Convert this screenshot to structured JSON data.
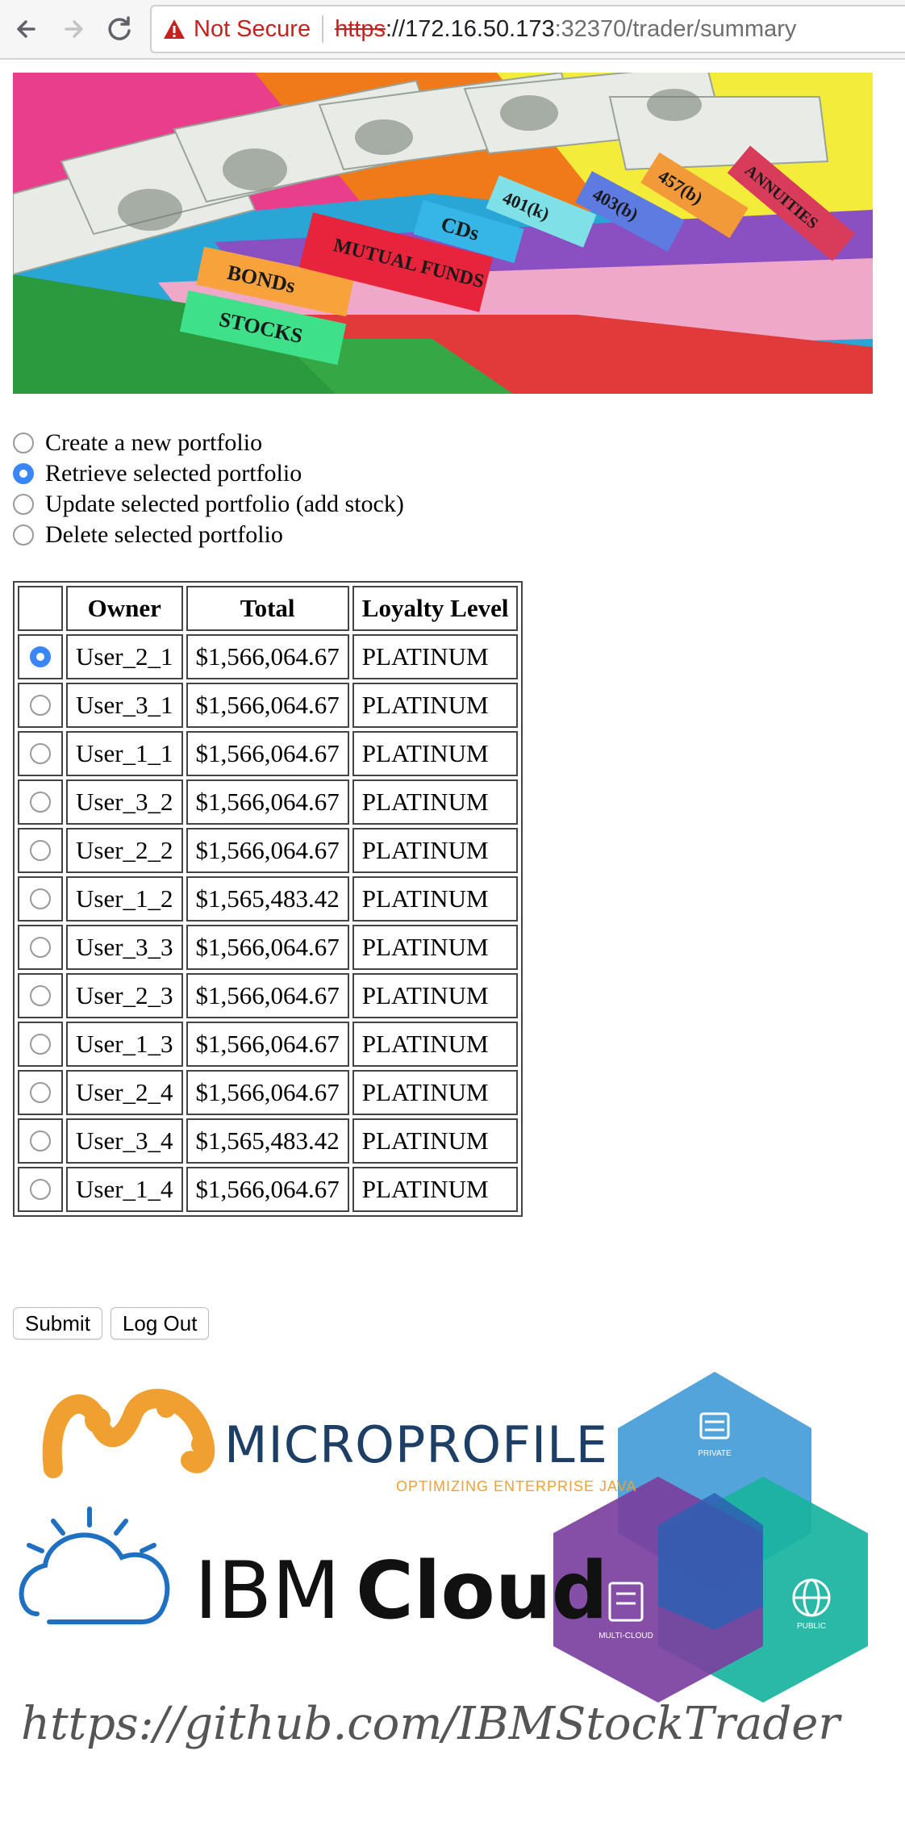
{
  "browser": {
    "security_label": "Not Secure",
    "url_scheme": "https",
    "url_host": "://172.16.50.173",
    "url_rest": ":32370/trader/summary"
  },
  "banner": {
    "tabs": [
      "STOCKS",
      "BONDs",
      "MUTUAL FUNDS",
      "CDs",
      "401(k)",
      "403(b)",
      "457(b)",
      "ANNUITIES"
    ]
  },
  "options": [
    {
      "label": "Create a new portfolio",
      "checked": false
    },
    {
      "label": "Retrieve selected portfolio",
      "checked": true
    },
    {
      "label": "Update selected portfolio (add stock)",
      "checked": false
    },
    {
      "label": "Delete selected portfolio",
      "checked": false
    }
  ],
  "table": {
    "headers": [
      "",
      "Owner",
      "Total",
      "Loyalty Level"
    ],
    "rows": [
      {
        "owner": "User_2_1",
        "total": "$1,566,064.67",
        "loyalty": "PLATINUM",
        "selected": true
      },
      {
        "owner": "User_3_1",
        "total": "$1,566,064.67",
        "loyalty": "PLATINUM",
        "selected": false
      },
      {
        "owner": "User_1_1",
        "total": "$1,566,064.67",
        "loyalty": "PLATINUM",
        "selected": false
      },
      {
        "owner": "User_3_2",
        "total": "$1,566,064.67",
        "loyalty": "PLATINUM",
        "selected": false
      },
      {
        "owner": "User_2_2",
        "total": "$1,566,064.67",
        "loyalty": "PLATINUM",
        "selected": false
      },
      {
        "owner": "User_1_2",
        "total": "$1,565,483.42",
        "loyalty": "PLATINUM",
        "selected": false
      },
      {
        "owner": "User_3_3",
        "total": "$1,566,064.67",
        "loyalty": "PLATINUM",
        "selected": false
      },
      {
        "owner": "User_2_3",
        "total": "$1,566,064.67",
        "loyalty": "PLATINUM",
        "selected": false
      },
      {
        "owner": "User_1_3",
        "total": "$1,566,064.67",
        "loyalty": "PLATINUM",
        "selected": false
      },
      {
        "owner": "User_2_4",
        "total": "$1,566,064.67",
        "loyalty": "PLATINUM",
        "selected": false
      },
      {
        "owner": "User_3_4",
        "total": "$1,565,483.42",
        "loyalty": "PLATINUM",
        "selected": false
      },
      {
        "owner": "User_1_4",
        "total": "$1,566,064.67",
        "loyalty": "PLATINUM",
        "selected": false
      }
    ]
  },
  "buttons": {
    "submit": "Submit",
    "logout": "Log Out"
  },
  "footer": {
    "microprofile_name": "MICROPROFILE",
    "microprofile_tagline": "OPTIMIZING ENTERPRISE JAVA",
    "ibm_text": "IBM",
    "cloud_text": "Cloud",
    "cube_labels": [
      "PRIVATE",
      "MULTI-CLOUD",
      "PUBLIC"
    ],
    "github_url": "https://github.com/IBMStockTrader"
  },
  "colors": {
    "not_secure": "#c5221f",
    "radio_selected": "#3b86f7",
    "microprofile_orange": "#f0a030",
    "microprofile_blue": "#1d3f66",
    "ibm_cloud_blue": "#1f70c1",
    "cube_blue": "#4a9fd8",
    "cube_purple": "#7b3fa0",
    "cube_teal": "#19b3a0"
  }
}
